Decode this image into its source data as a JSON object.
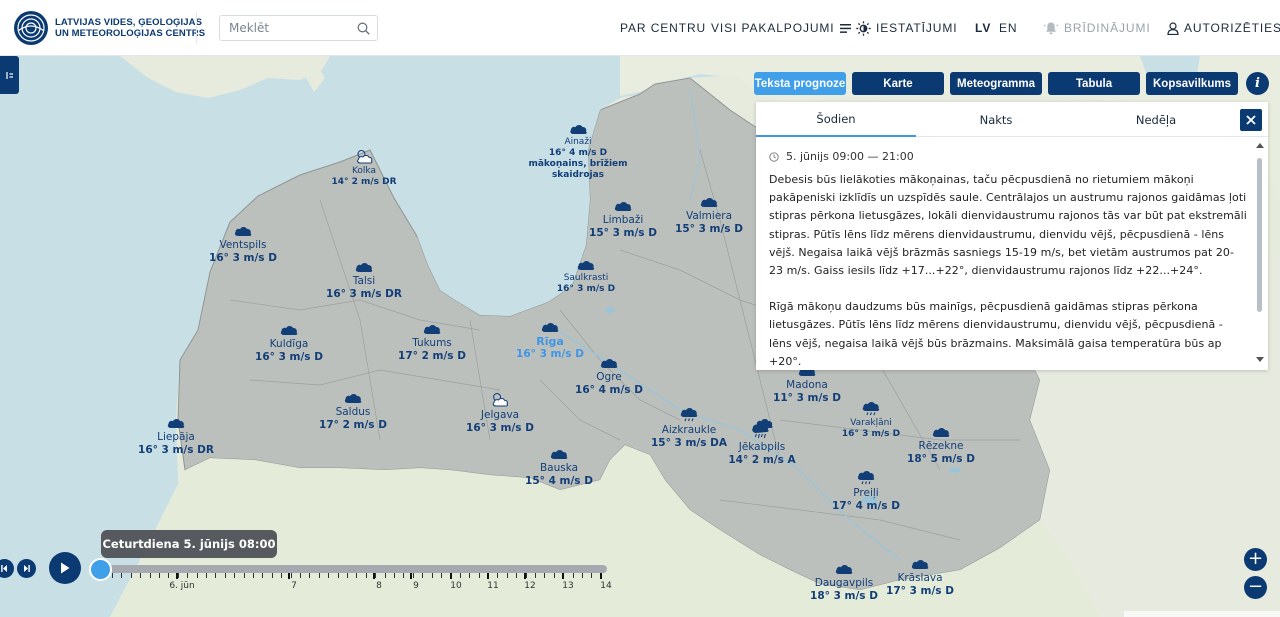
{
  "header": {
    "logo_line1": "LATVIJAS VIDES, ĢEOLOĢIJAS",
    "logo_line2": "UN METEOROLOĢIJAS CENTRS",
    "search_placeholder": "Meklēt",
    "nav": {
      "about": "PAR CENTRU",
      "services": "VISI PAKALPOJUMI",
      "settings": "IESTATĪJUMI",
      "lang_lv": "LV",
      "lang_en": "EN",
      "warnings": "BRĪDINĀJUMI",
      "login": "AUTORIZĒTIES"
    }
  },
  "view_buttons": {
    "text_forecast": "Teksta prognoze",
    "map": "Karte",
    "meteogram": "Meteogramma",
    "table": "Tabula",
    "summary": "Kopsavilkums",
    "info": "i"
  },
  "panel": {
    "tabs": {
      "today": "Šodien",
      "night": "Nakts",
      "week": "Nedēļa"
    },
    "period": "5. jūnijs 09:00 — 21:00",
    "paragraph1": "Debesis būs lielākoties mākoņainas, taču pēcpusdienā no rietumiem mākoņi pakāpeniski izklīdīs un uzspīdēs saule. Centrālajos un austrumu rajonos gaidāmas ļoti stipras pērkona lietusgāzes, lokāli dienvidaustrumu rajonos tās var būt pat ekstremāli stipras. Pūtīs lēns līdz mērens dienvidaustrumu, dienvidu vējš, pēcpusdienā - lēns vējš. Negaisa laikā vējš brāzmās sasniegs 15-19 m/s, bet vietām austrumos pat 20-23 m/s. Gaiss iesils līdz +17...+22°, dienvidaustrumu rajonos līdz +22...+24°.",
    "paragraph2": "Rīgā mākoņu daudzums būs mainīgs, pēcpusdienā gaidāmas stipras pērkona lietusgāzes. Pūtīs lēns līdz mērens dienvidaustrumu, dienvidu vējš, pēcpusdienā - lēns vējš, negaisa laikā vējš būs brāzmains. Maksimālā gaisa temperatūra būs ap +20°."
  },
  "stations": [
    {
      "id": "ainazi",
      "name": "Ainaži",
      "value": "16° 4 m/s D",
      "extra1": "mākoņains, brīžiem",
      "extra2": "skaidrojas",
      "icon": "cloud-icon"
    },
    {
      "id": "kolka",
      "name": "Kolka",
      "value": "14° 2 m/s DR",
      "icon": "partly-cloudy-icon"
    },
    {
      "id": "ventspils",
      "name": "Ventspils",
      "value": "16° 3 m/s D",
      "icon": "cloud-icon"
    },
    {
      "id": "limbazi",
      "name": "Limbaži",
      "value": "15° 3 m/s D",
      "icon": "cloud-icon"
    },
    {
      "id": "valmiera",
      "name": "Valmiera",
      "value": "15° 3 m/s D",
      "icon": "cloud-icon"
    },
    {
      "id": "talsi",
      "name": "Talsi",
      "value": "16° 3 m/s DR",
      "icon": "cloud-icon"
    },
    {
      "id": "saulkrasti",
      "name": "Saulkrasti",
      "value": "16° 3 m/s D",
      "icon": "cloud-icon"
    },
    {
      "id": "kuldiga",
      "name": "Kuldīga",
      "value": "16° 3 m/s D",
      "icon": "cloud-icon"
    },
    {
      "id": "tukums",
      "name": "Tukums",
      "value": "17° 2 m/s D",
      "icon": "cloud-icon"
    },
    {
      "id": "riga",
      "name": "Rīga",
      "value": "16° 3 m/s D",
      "icon": "cloud-icon"
    },
    {
      "id": "ogre",
      "name": "Ogre",
      "value": "16° 4 m/s D",
      "icon": "cloud-icon"
    },
    {
      "id": "madona",
      "name": "Madona",
      "value": "11° 3 m/s D",
      "icon": "cloud-icon"
    },
    {
      "id": "saldus",
      "name": "Saldus",
      "value": "17° 2 m/s D",
      "icon": "cloud-icon"
    },
    {
      "id": "jelgava",
      "name": "Jelgava",
      "value": "16° 3 m/s D",
      "icon": "partly-cloudy-icon"
    },
    {
      "id": "aizkraukle",
      "name": "Aizkraukle",
      "value": "15° 3 m/s DA",
      "icon": "rain-icon"
    },
    {
      "id": "jekabpils",
      "name": "Jēkabpils",
      "value": "14° 2 m/s A",
      "icon": "heavy-rain-icon"
    },
    {
      "id": "varaklani",
      "name": "Varakļāni",
      "value": "16° 3 m/s D",
      "icon": "rain-icon"
    },
    {
      "id": "rezekne",
      "name": "Rēzekne",
      "value": "18° 5 m/s D",
      "icon": "cloud-icon"
    },
    {
      "id": "liepaja",
      "name": "Liepāja",
      "value": "16° 3 m/s DR",
      "icon": "cloud-icon"
    },
    {
      "id": "bauska",
      "name": "Bauska",
      "value": "15° 4 m/s D",
      "icon": "cloud-icon"
    },
    {
      "id": "preili",
      "name": "Preiļi",
      "value": "17° 4 m/s D",
      "icon": "rain-icon"
    },
    {
      "id": "daugavpils",
      "name": "Daugavpils",
      "value": "18° 3 m/s D",
      "icon": "cloud-icon"
    },
    {
      "id": "kraslava",
      "name": "Krāslava",
      "value": "17° 3 m/s D",
      "icon": "cloud-icon"
    }
  ],
  "timeline": {
    "current": "Ceturtdiena 5. jūnijs 08:00",
    "tick_labels": [
      "6. jūn",
      "7",
      "8",
      "9",
      "10",
      "11",
      "12",
      "13",
      "14"
    ]
  },
  "zoom": {
    "in": "+",
    "out": "−"
  },
  "colors": {
    "brand": "#0b3a72",
    "accent": "#3f9fe8",
    "latvia_fill": "#bfc3c0",
    "sea": "#c5dde4"
  }
}
